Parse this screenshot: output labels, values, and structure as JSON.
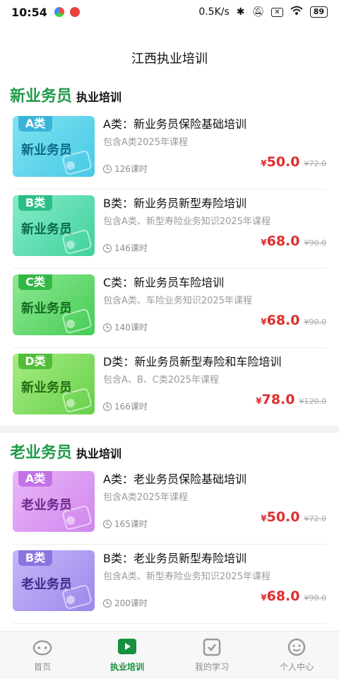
{
  "status_bar": {
    "time": "10:54",
    "net_speed": "0.5K/s",
    "battery": "89"
  },
  "header": {
    "title": "江西执业培训"
  },
  "sections": [
    {
      "main": "新业务员",
      "sub": "执业培训"
    },
    {
      "main": "老业务员",
      "sub": "执业培训"
    }
  ],
  "courses": [
    {
      "tag": "A类",
      "thumb_title": "新业务员",
      "name": "A类：新业务员保险基础培训",
      "desc": "包含A类2025年课程",
      "hours": "126课时",
      "currency": "¥",
      "price": "50.0",
      "old_price": "¥72.0",
      "colors": [
        "#7fe3f0",
        "#48c9e6"
      ],
      "tag_color": "#39b4d8",
      "text_color": "#0d6b86"
    },
    {
      "tag": "B类",
      "thumb_title": "新业务员",
      "name": "B类：新业务员新型寿险培训",
      "desc": "包含A类、新型寿险业务知识2025年课程",
      "hours": "146课时",
      "currency": "¥",
      "price": "68.0",
      "old_price": "¥90.0",
      "colors": [
        "#86ecc9",
        "#3fd19c"
      ],
      "tag_color": "#2bbf87",
      "text_color": "#0e6b4a"
    },
    {
      "tag": "C类",
      "thumb_title": "新业务员",
      "name": "C类：新业务员车险培训",
      "desc": "包含A类、车险业务知识2025年课程",
      "hours": "140课时",
      "currency": "¥",
      "price": "68.0",
      "old_price": "¥90.0",
      "colors": [
        "#8fe893",
        "#45cc55"
      ],
      "tag_color": "#33b845",
      "text_color": "#146b22"
    },
    {
      "tag": "D类",
      "thumb_title": "新业务员",
      "name": "D类：新业务员新型寿险和车险培训",
      "desc": "包含A、B、C类2025年课程",
      "hours": "166课时",
      "currency": "¥",
      "price": "78.0",
      "old_price": "¥120.0",
      "colors": [
        "#a7ec82",
        "#66d04b"
      ],
      "tag_color": "#52bd38",
      "text_color": "#246b12"
    },
    {
      "tag": "A类",
      "thumb_title": "老业务员",
      "name": "A类：老业务员保险基础培训",
      "desc": "包含A类2025年课程",
      "hours": "165课时",
      "currency": "¥",
      "price": "50.0",
      "old_price": "¥72.0",
      "colors": [
        "#eab6f7",
        "#cf86ee"
      ],
      "tag_color": "#c173e6",
      "text_color": "#6a2a8a"
    },
    {
      "tag": "B类",
      "thumb_title": "老业务员",
      "name": "B类：老业务员新型寿险培训",
      "desc": "包含A类、新型寿险业务知识2025年课程",
      "hours": "200课时",
      "currency": "¥",
      "price": "68.0",
      "old_price": "¥90.0",
      "colors": [
        "#c7b6f7",
        "#9d87ec"
      ],
      "tag_color": "#8c74e0",
      "text_color": "#3f2a8a"
    }
  ],
  "tabs": [
    {
      "label": "首页",
      "icon": "face-icon"
    },
    {
      "label": "执业培训",
      "icon": "play-icon"
    },
    {
      "label": "我的学习",
      "icon": "checkbox-icon"
    },
    {
      "label": "个人中心",
      "icon": "smile-icon"
    }
  ],
  "theme": {
    "accent": "#1f9a4b",
    "price": "#e02d2d"
  }
}
